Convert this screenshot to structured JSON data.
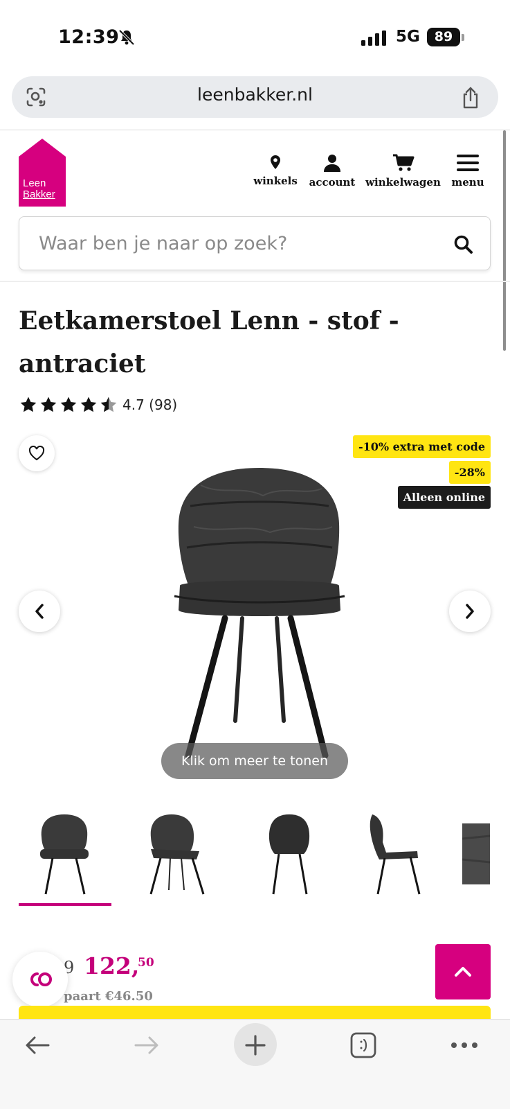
{
  "status_bar": {
    "time": "12:39",
    "network": "5G",
    "battery": "89"
  },
  "browser": {
    "url": "leenbakker.nl"
  },
  "header": {
    "logo_line1": "Leen",
    "logo_line2": "Bakker",
    "nav": [
      {
        "label": "winkels",
        "icon": "location-pin-icon"
      },
      {
        "label": "account",
        "icon": "user-icon"
      },
      {
        "label": "winkelwagen",
        "icon": "cart-icon"
      },
      {
        "label": "menu",
        "icon": "hamburger-icon"
      }
    ],
    "search": {
      "placeholder": "Waar ben je naar op zoek?"
    }
  },
  "product": {
    "title": "Eetkamerstoel Lenn - stof - antraciet",
    "rating": 4.7,
    "rating_text": "4.7 (98)",
    "badges": [
      "-10% extra met code",
      "-28%",
      "Alleen online"
    ],
    "gallery_overlay": "Klik om meer te tonen",
    "thumbnails": [
      "front",
      "angle",
      "back",
      "side",
      "fabric"
    ],
    "price": {
      "old_fragment": "9",
      "main": "122,",
      "cents": "50",
      "savings": "paart €46.50"
    }
  },
  "colors": {
    "brand": "#d6007f",
    "price": "#c4007a",
    "badge": "#ffe512"
  }
}
